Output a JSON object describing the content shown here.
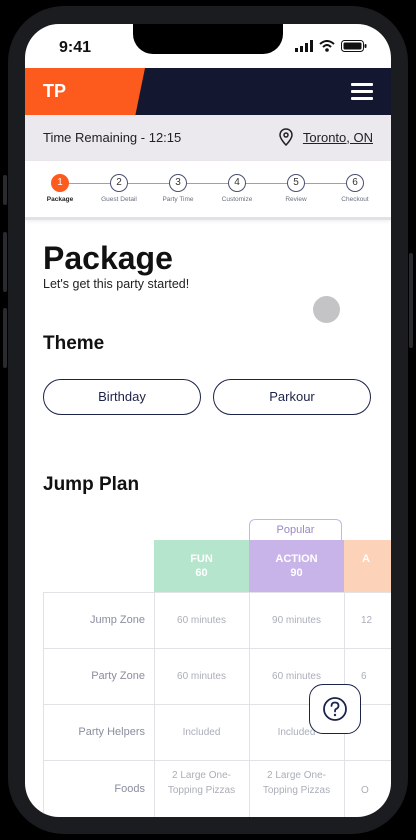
{
  "status_bar": {
    "time": "9:41"
  },
  "header": {
    "logo_text": "TP"
  },
  "time_bar": {
    "time_remaining": "Time Remaining - 12:15",
    "location": "Toronto, ON"
  },
  "steps": [
    {
      "number": "1",
      "label": "Package",
      "active": true
    },
    {
      "number": "2",
      "label": "Guest Detail"
    },
    {
      "number": "3",
      "label": "Party Time"
    },
    {
      "number": "4",
      "label": "Customize"
    },
    {
      "number": "5",
      "label": "Review"
    },
    {
      "number": "6",
      "label": "Checkout"
    }
  ],
  "page": {
    "title": "Package",
    "subtitle": "Let's get this party started!"
  },
  "theme": {
    "heading": "Theme",
    "options": [
      "Birthday",
      "Parkour"
    ]
  },
  "jump_plan": {
    "heading": "Jump Plan",
    "popular_badge": "Popular",
    "plans": [
      {
        "name": "FUN",
        "value": "60",
        "color": "#b5e6cd"
      },
      {
        "name": "ACTION",
        "value": "90",
        "color": "#c9b4e9"
      },
      {
        "name": "A",
        "value": "",
        "color": "#fcd3b8"
      }
    ],
    "rows": [
      {
        "label": "Jump Zone",
        "cells": [
          "60 minutes",
          "90 minutes",
          "12"
        ]
      },
      {
        "label": "Party Zone",
        "cells": [
          "60 minutes",
          "60 minutes",
          "6"
        ]
      },
      {
        "label": "Party Helpers",
        "cells": [
          "Included",
          "Included",
          ""
        ]
      },
      {
        "label": "Foods",
        "cells": [
          "2 Large One-Topping Pizzas",
          "2 Large One-Topping Pizzas",
          "O"
        ]
      }
    ]
  },
  "colors": {
    "brand_orange": "#fd5a1e",
    "navy": "#131830",
    "outline_navy": "#1c2348"
  },
  "icons": {
    "menu": "hamburger-menu-icon",
    "location": "location-pin-icon",
    "help": "question-mark-icon"
  }
}
